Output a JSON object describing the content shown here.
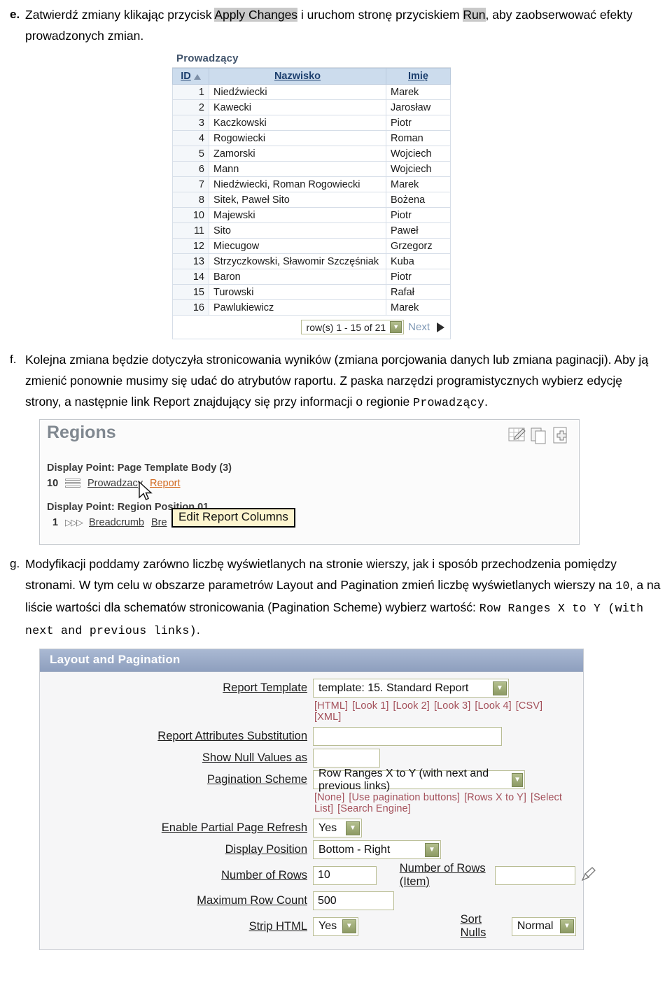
{
  "steps": {
    "e": {
      "marker": "e.",
      "t1": "Zatwierdź zmiany klikając przycisk ",
      "hl1": "Apply Changes",
      "t2": " i uruchom stronę przyciskiem ",
      "hl2": "Run",
      "t3": ", aby zaobserwować efekty prowadzonych zmian."
    },
    "f": {
      "marker": "f.",
      "t1": "Kolejna zmiana będzie dotyczyła stronicowania wyników (zmiana porcjowania danych lub zmiana paginacji). Aby ją zmienić ponownie musimy się udać do atrybutów raportu. Z paska narzędzi programistycznych wybierz edycję strony, a następnie link ",
      "ui1": "Report",
      "t2": " znajdujący się przy informacji o regionie ",
      "mono1": "Prowadzący",
      "t3": "."
    },
    "g": {
      "marker": "g.",
      "t1": "Modyfikacji poddamy zarówno liczbę wyświetlanych na stronie wierszy, jak i sposób przechodzenia pomiędzy stronami. W tym celu w obszarze parametrów ",
      "ui1": "Layout and Pagination",
      "t2": " zmień liczbę wyświetlanych wierszy na ",
      "mono1": "10",
      "t3": ", a na liście wartości dla schematów stronicowania (",
      "ui2": "Pagination Scheme",
      "t4": ") wybierz wartość: ",
      "mono2": "Row Ranges X to Y (with next and previous links)",
      "t5": "."
    }
  },
  "report": {
    "title": "Prowadzący",
    "columns": [
      "ID",
      "Nazwisko",
      "Imię"
    ],
    "sort_column": "ID",
    "sort_direction": "asc",
    "rows": [
      {
        "id": "1",
        "nazwisko": "Niedźwiecki",
        "imie": "Marek"
      },
      {
        "id": "2",
        "nazwisko": "Kawecki",
        "imie": "Jarosław"
      },
      {
        "id": "3",
        "nazwisko": "Kaczkowski",
        "imie": "Piotr"
      },
      {
        "id": "4",
        "nazwisko": "Rogowiecki",
        "imie": "Roman"
      },
      {
        "id": "5",
        "nazwisko": "Zamorski",
        "imie": "Wojciech"
      },
      {
        "id": "6",
        "nazwisko": "Mann",
        "imie": "Wojciech"
      },
      {
        "id": "7",
        "nazwisko": "Niedźwiecki, Roman Rogowiecki",
        "imie": "Marek"
      },
      {
        "id": "8",
        "nazwisko": "Sitek, Paweł Sito",
        "imie": "Bożena"
      },
      {
        "id": "10",
        "nazwisko": "Majewski",
        "imie": "Piotr"
      },
      {
        "id": "11",
        "nazwisko": "Sito",
        "imie": "Paweł"
      },
      {
        "id": "12",
        "nazwisko": "Miecugow",
        "imie": "Grzegorz"
      },
      {
        "id": "13",
        "nazwisko": "Strzyczkowski, Sławomir Szczęśniak",
        "imie": "Kuba"
      },
      {
        "id": "14",
        "nazwisko": "Baron",
        "imie": "Piotr"
      },
      {
        "id": "15",
        "nazwisko": "Turowski",
        "imie": "Rafał"
      },
      {
        "id": "16",
        "nazwisko": "Pawlukiewicz",
        "imie": "Marek"
      }
    ],
    "pagination_text": "row(s) 1 - 15 of 21",
    "next_label": "Next"
  },
  "regions": {
    "title": "Regions",
    "icons": [
      "edit-grid-pencil-icon",
      "copy-pages-icon",
      "add-page-icon"
    ],
    "group1_label": "Display Point: Page Template Body (3)",
    "row1": {
      "seq": "10",
      "name": "Prowadzacy",
      "link": "Report"
    },
    "group2_label": "Display Point: Region Position 01",
    "row2": {
      "seq": "1",
      "name": "Breadcrumb",
      "link": "Bre"
    },
    "tooltip": "Edit Report Columns"
  },
  "layout": {
    "title": "Layout and Pagination",
    "report_template": {
      "label": "Report Template",
      "value": "template: 15. Standard Report",
      "looks": [
        "[HTML]",
        "[Look 1]",
        "[Look 2]",
        "[Look 3]",
        "[Look 4]",
        "[CSV]",
        "[XML]"
      ]
    },
    "report_attributes_substitution": {
      "label": "Report Attributes Substitution",
      "value": ""
    },
    "show_null_values_as": {
      "label": "Show Null Values as",
      "value": ""
    },
    "pagination_scheme": {
      "label": "Pagination Scheme",
      "value": "Row Ranges X to Y (with next and previous links)",
      "options_hint": [
        "[None]",
        "[Use pagination buttons]",
        "[Rows X to Y]",
        "[Select List]",
        "[Search Engine]"
      ]
    },
    "enable_partial_page_refresh": {
      "label": "Enable Partial Page Refresh",
      "value": "Yes"
    },
    "display_position": {
      "label": "Display Position",
      "value": "Bottom - Right"
    },
    "number_of_rows": {
      "label": "Number of Rows",
      "value": "10"
    },
    "number_of_rows_item": {
      "label": "Number of Rows (Item)",
      "value": ""
    },
    "maximum_row_count": {
      "label": "Maximum Row Count",
      "value": "500"
    },
    "strip_html": {
      "label": "Strip HTML",
      "value": "Yes"
    },
    "sort_nulls": {
      "label": "Sort Nulls",
      "value": "Normal"
    }
  },
  "colors": {
    "highlight": "#c9c9c9",
    "table_header_bg": "#ccdced",
    "table_header_text": "#1c3f6e",
    "panel_header_bg": "#8e9fbe",
    "link_orange": "#d2691e",
    "looks_link": "#a4515b",
    "field_border": "#b9bd94",
    "tooltip_bg": "#fdf5cf"
  }
}
